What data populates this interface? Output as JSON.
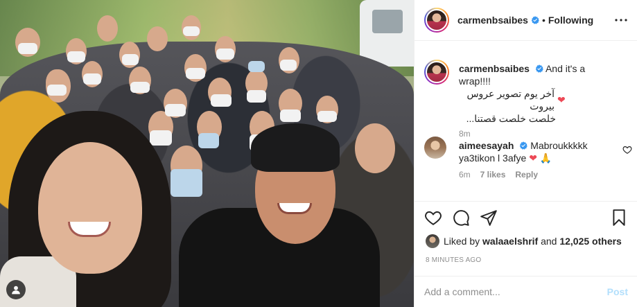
{
  "header": {
    "username": "carmenbsaibes",
    "separator": "•",
    "follow_status": "Following"
  },
  "caption": {
    "username": "carmenbsaibes",
    "text": "And it's a wrap!!!!",
    "arabic_line1": "آخر يوم تصوير عروس بيروت",
    "arabic_line2": "خلصت خلصت قصتنا...",
    "time": "8m"
  },
  "comment": {
    "username": "aimeesayah",
    "text": "Mabroukkkkk",
    "text_line2": "ya3tikon l 3afye",
    "time": "6m",
    "likes": "7 likes",
    "reply_label": "Reply"
  },
  "likes": {
    "prefix": "Liked by",
    "user": "walaaelshrif",
    "joiner": "and",
    "others": "12,025 others"
  },
  "timestamp": "8 MINUTES AGO",
  "add_comment": {
    "placeholder": "Add a comment...",
    "post_label": "Post"
  },
  "colors": {
    "verified": "#3897f0",
    "heart_red": "#ed4956",
    "post_disabled": "#b2dffc",
    "muted": "#8e8e8e"
  },
  "icons": [
    "user-tag-icon",
    "more-options-icon",
    "verified-badge-icon",
    "heart-emoji-icon",
    "pray-emoji-icon",
    "like-heart-icon",
    "comment-icon",
    "share-icon",
    "save-bookmark-icon"
  ]
}
